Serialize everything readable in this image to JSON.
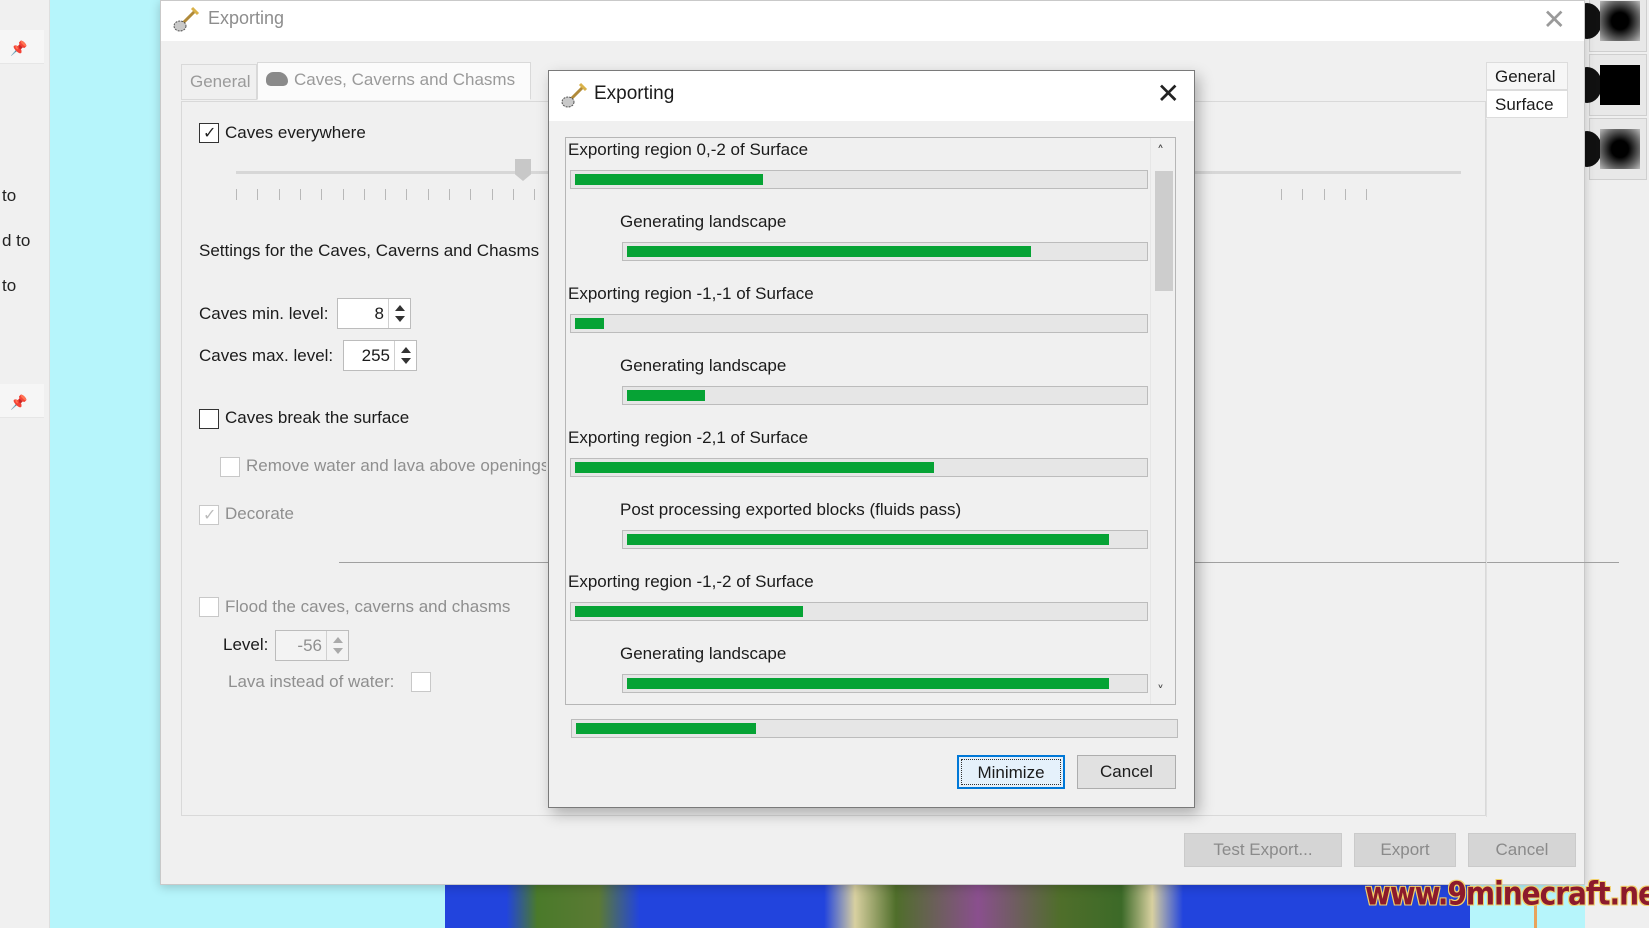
{
  "left_panel": {
    "labels": [
      "to",
      "d to",
      "to"
    ]
  },
  "main_window": {
    "title": "Exporting",
    "icon": "shovel-icon",
    "close_icon": "close-icon",
    "tabs": [
      {
        "label": "General",
        "active": false
      },
      {
        "label": "Caves, Caverns and Chasms",
        "active": true,
        "icon": "cloud-icon"
      }
    ],
    "right_tabs": [
      {
        "label": "General",
        "selected": false
      },
      {
        "label": "Surface",
        "selected": true
      }
    ],
    "caves_tab": {
      "caves_everywhere": {
        "label": "Caves everywhere",
        "checked": true
      },
      "slider": {
        "value_fraction": 0.36,
        "tick_count": 50
      },
      "settings_heading": "Settings for the Caves, Caverns and Chasms",
      "caves_min_level": {
        "label": "Caves min. level:",
        "value": "8"
      },
      "caves_max_level": {
        "label": "Caves max. level:",
        "value": "255"
      },
      "caves_break_surface": {
        "label": "Caves break the surface",
        "checked": false
      },
      "remove_water_lava": {
        "label": "Remove water and lava above openings",
        "checked": false,
        "disabled": true
      },
      "decorate": {
        "label": "Decorate",
        "checked": true,
        "disabled": true
      },
      "flood": {
        "label": "Flood the caves, caverns and chasms",
        "checked": false,
        "disabled": true
      },
      "flood_level": {
        "label": "Level:",
        "value": "-56",
        "disabled": true
      },
      "lava_instead": {
        "label": "Lava instead of water:",
        "checked": false,
        "disabled": true
      }
    },
    "buttons": {
      "test_export": "Test Export...",
      "export": "Export",
      "cancel": "Cancel"
    }
  },
  "progress_dialog": {
    "title": "Exporting",
    "icon": "shovel-icon",
    "close_icon": "close-icon",
    "items": [
      {
        "label": "Exporting region 0,-2 of Surface",
        "level": 0,
        "progress": 0.33
      },
      {
        "label": "Generating landscape",
        "level": 1,
        "progress": 0.78
      },
      {
        "label": "Exporting region -1,-1 of Surface",
        "level": 0,
        "progress": 0.05
      },
      {
        "label": "Generating landscape",
        "level": 1,
        "progress": 0.15
      },
      {
        "label": "Exporting region -2,1 of Surface",
        "level": 0,
        "progress": 0.63
      },
      {
        "label": "Post processing exported blocks (fluids pass)",
        "level": 1,
        "progress": 0.93
      },
      {
        "label": "Exporting region -1,-2 of Surface",
        "level": 0,
        "progress": 0.4
      },
      {
        "label": "Generating landscape",
        "level": 1,
        "progress": 0.93
      }
    ],
    "overall_progress": 0.3,
    "buttons": {
      "minimize": "Minimize",
      "cancel": "Cancel"
    },
    "colors": {
      "progress_fill": "#06a335",
      "focus_border": "#0078d7"
    }
  },
  "watermark": "www.9minecraft.net"
}
